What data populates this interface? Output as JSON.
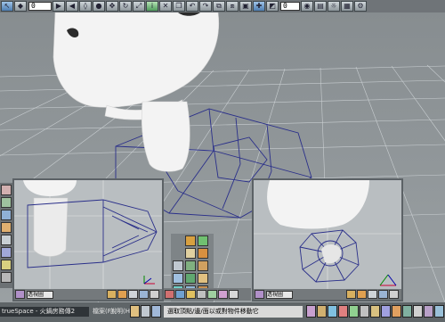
{
  "toolbar": {
    "frame_value": "0",
    "frame_value_2": "0"
  },
  "panel_left": {
    "name": "透視圖"
  },
  "panel_right": {
    "name": "透視圖"
  },
  "statusbar": {
    "app_title": "trueSpace - 火鍋房務傳2",
    "menu_file": "檔案(F)",
    "menu_help": "說明(H)",
    "hint": "選取頂點/邊/面以或對物件移動它"
  },
  "colors": {
    "background": "#8f9598",
    "grid": "#ffffff",
    "wire": "#2a2f8a",
    "model": "#f4f4f4"
  }
}
